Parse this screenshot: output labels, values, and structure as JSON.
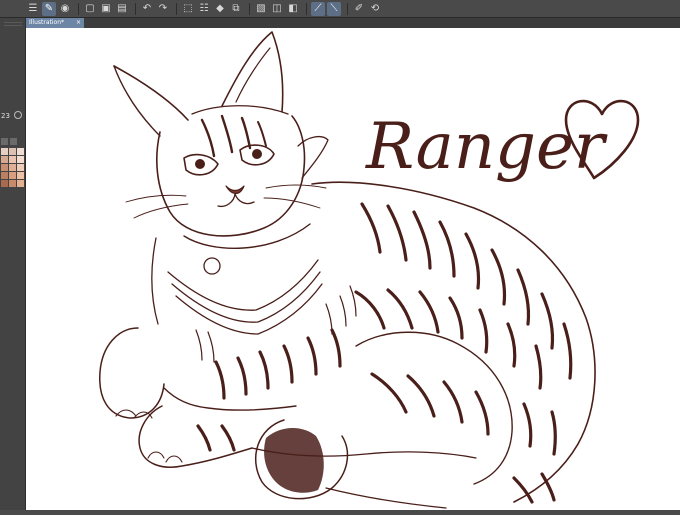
{
  "toolbar": {
    "items": [
      {
        "name": "menu-icon",
        "glyph": "☰",
        "active": false
      },
      {
        "name": "pen-tool-icon",
        "glyph": "✎",
        "active": true
      },
      {
        "name": "eye-icon",
        "glyph": "◉",
        "active": false
      },
      {
        "name": "sep",
        "glyph": "",
        "active": false
      },
      {
        "name": "new-file-icon",
        "glyph": "▢",
        "active": false
      },
      {
        "name": "open-folder-icon",
        "glyph": "▣",
        "active": false
      },
      {
        "name": "save-icon",
        "glyph": "▤",
        "active": false
      },
      {
        "name": "sep",
        "glyph": "",
        "active": false
      },
      {
        "name": "undo-icon",
        "glyph": "↶",
        "active": false
      },
      {
        "name": "redo-icon",
        "glyph": "↷",
        "active": false
      },
      {
        "name": "sep",
        "glyph": "",
        "active": false
      },
      {
        "name": "selection-icon",
        "glyph": "⬚",
        "active": false
      },
      {
        "name": "clear-icon",
        "glyph": "☷",
        "active": false
      },
      {
        "name": "fill-icon",
        "glyph": "◆",
        "active": false
      },
      {
        "name": "transform-icon",
        "glyph": "⧉",
        "active": false
      },
      {
        "name": "sep",
        "glyph": "",
        "active": false
      },
      {
        "name": "crop-icon",
        "glyph": "▧",
        "active": false
      },
      {
        "name": "deselect-icon",
        "glyph": "◫",
        "active": false
      },
      {
        "name": "invert-icon",
        "glyph": "◧",
        "active": false
      },
      {
        "name": "sep",
        "glyph": "",
        "active": false
      },
      {
        "name": "ruler-snap-icon",
        "glyph": "⟋",
        "active": true
      },
      {
        "name": "grid-snap-icon",
        "glyph": "⟍",
        "active": true
      },
      {
        "name": "sep",
        "glyph": "",
        "active": false
      },
      {
        "name": "edit-icon",
        "glyph": "✐",
        "active": false
      },
      {
        "name": "rotate-icon",
        "glyph": "⟲",
        "active": false
      }
    ]
  },
  "tabs": [
    {
      "label": "Illustration*",
      "close": "×"
    }
  ],
  "left_panel": {
    "brush_size": "23"
  },
  "palette": [
    "#e8cfc3",
    "#dcc0b3",
    "#efdcd2",
    "#d6a890",
    "#e9c4b0",
    "#f3ddcf",
    "#c98f73",
    "#e0b096",
    "#f0cdb8",
    "#bb7f62",
    "#d99e80",
    "#eec0a4",
    "#a86b50",
    "#c88a6b",
    "#e4b08f"
  ],
  "canvas": {
    "title_text": "Ranger",
    "ink_color": "#4a1f1a"
  }
}
